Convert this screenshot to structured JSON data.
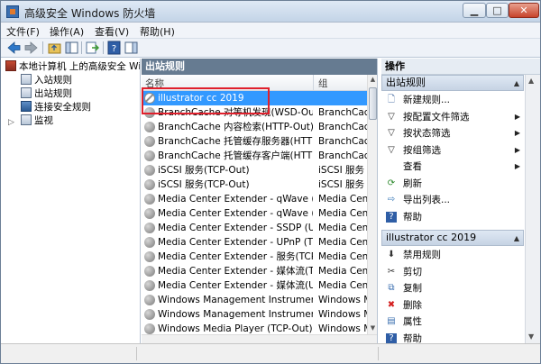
{
  "window": {
    "title": "高级安全 Windows 防火墙"
  },
  "menu": [
    "文件(F)",
    "操作(A)",
    "查看(V)",
    "帮助(H)"
  ],
  "tree": {
    "root": "本地计算机 上的高级安全 Windows",
    "items": [
      "入站规则",
      "出站规则",
      "连接安全规则",
      "监视"
    ]
  },
  "middle": {
    "header": "出站规则",
    "columns": {
      "name": "名称",
      "group": "组"
    },
    "rows": [
      {
        "name": "illustrator cc 2019",
        "group": "",
        "icon": "blocked-icon"
      },
      {
        "name": "BranchCache 对等机发现(WSD-Out)",
        "group": "BranchCache"
      },
      {
        "name": "BranchCache 内容检索(HTTP-Out)",
        "group": "BranchCache"
      },
      {
        "name": "BranchCache 托管缓存服务器(HTTP-O...",
        "group": "BranchCache"
      },
      {
        "name": "BranchCache 托管缓存客户端(HTTP-O...",
        "group": "BranchCache"
      },
      {
        "name": "iSCSI 服务(TCP-Out)",
        "group": "iSCSI 服务"
      },
      {
        "name": "iSCSI 服务(TCP-Out)",
        "group": "iSCSI 服务"
      },
      {
        "name": "Media Center Extender - qWave (TCP-...",
        "group": "Media Cente"
      },
      {
        "name": "Media Center Extender - qWave (UD...",
        "group": "Media Cente"
      },
      {
        "name": "Media Center Extender - SSDP (UDP-...",
        "group": "Media Cente"
      },
      {
        "name": "Media Center Extender - UPnP (TCP-...",
        "group": "Media Cente"
      },
      {
        "name": "Media Center Extender - 服务(TCP-...",
        "group": "Media Cente"
      },
      {
        "name": "Media Center Extender - 媒体流(TCP-...",
        "group": "Media Cente"
      },
      {
        "name": "Media Center Extender - 媒体流(UDP-...",
        "group": "Media Cente"
      },
      {
        "name": "Windows Management Instrumentati...",
        "group": "Windows M"
      },
      {
        "name": "Windows Management Instrumentati...",
        "group": "Windows M"
      },
      {
        "name": "Windows Media Player (TCP-Out)",
        "group": "Windows M"
      }
    ]
  },
  "actions": {
    "header": "操作",
    "section1": "出站规则",
    "items1": [
      "新建规则...",
      "按配置文件筛选",
      "按状态筛选",
      "按组筛选",
      "查看",
      "刷新",
      "导出列表...",
      "帮助"
    ],
    "section2": "illustrator cc 2019",
    "items2": [
      "禁用规则",
      "剪切",
      "复制",
      "删除",
      "属性",
      "帮助"
    ]
  }
}
